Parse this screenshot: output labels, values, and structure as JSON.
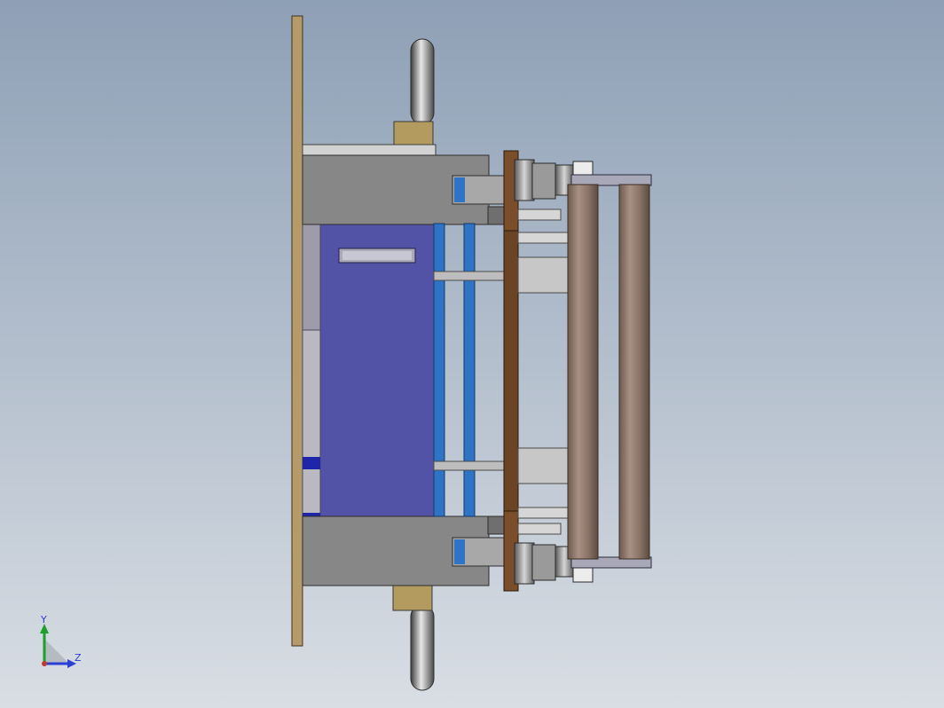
{
  "view": {
    "background_top": "#8ea0b6",
    "background_bottom": "#d9dee4"
  },
  "triad": {
    "y_label": "Y",
    "z_label": "Z",
    "y_color": "#1e9e2a",
    "z_color": "#2a3fd6",
    "label_color": "#2a3fd6"
  },
  "colors": {
    "base_plate": "#b59a6a",
    "steel": "#8a8a8a",
    "steel_light": "#c9c9c9",
    "bracket_block": "#b39a5e",
    "motor_body": "#5253a6",
    "blue_plate": "#2f74c4",
    "wood_plate": "#6a4424",
    "roller": "#8a7568"
  }
}
